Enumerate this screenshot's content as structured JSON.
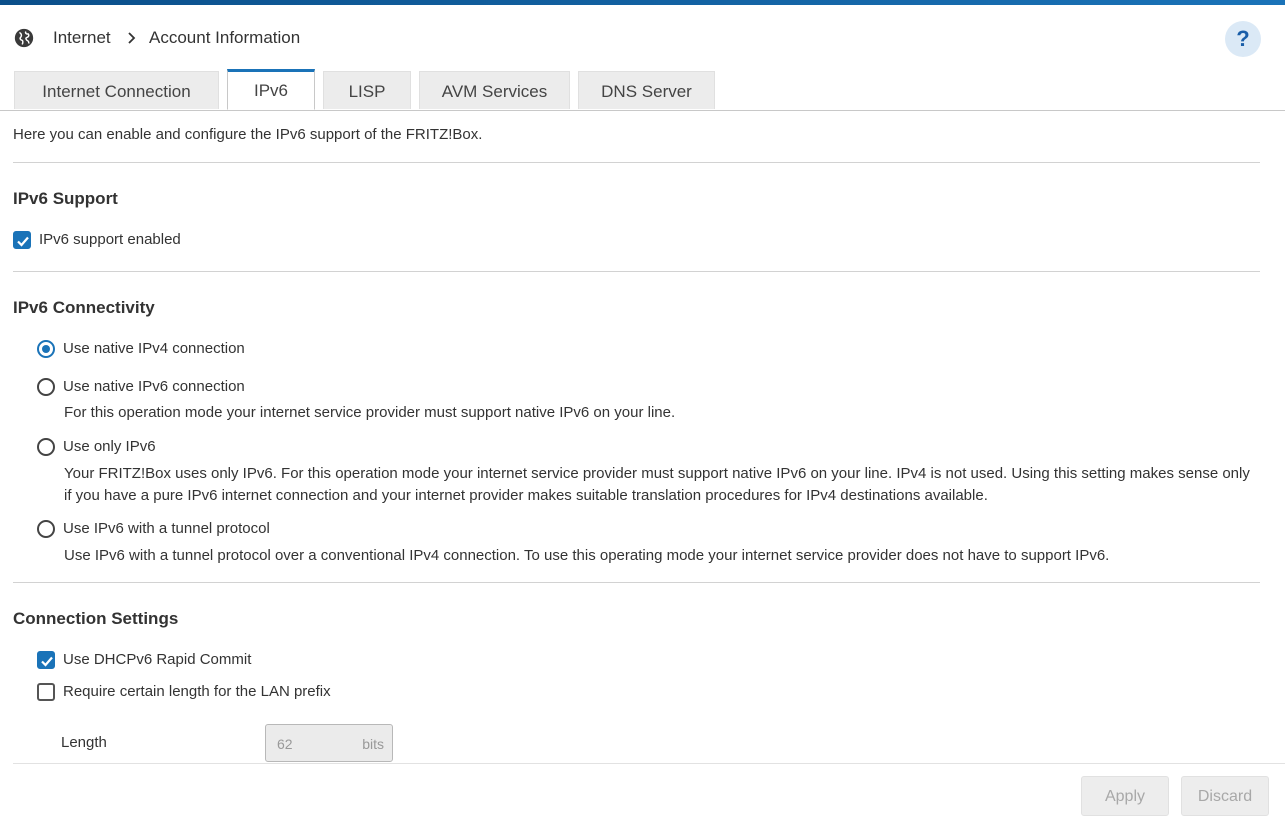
{
  "colors": {
    "accent": "#1a73b8",
    "topbar": "#0b4f8a",
    "help_bg": "#dbe9f6"
  },
  "breadcrumb": {
    "icon": "globe-icon",
    "root": "Internet",
    "separator_icon": "chevron-right-icon",
    "current": "Account Information"
  },
  "help": {
    "label": "?"
  },
  "tabs": [
    {
      "label": "Internet Connection",
      "active": false
    },
    {
      "label": "IPv6",
      "active": true
    },
    {
      "label": "LISP",
      "active": false
    },
    {
      "label": "AVM Services",
      "active": false
    },
    {
      "label": "DNS Server",
      "active": false
    }
  ],
  "intro": "Here you can enable and configure the IPv6 support of the FRITZ!Box.",
  "ipv6_support": {
    "heading": "IPv6 Support",
    "checkbox_label": "IPv6 support enabled",
    "checked": true
  },
  "connectivity": {
    "heading": "IPv6 Connectivity",
    "options": [
      {
        "label": "Use native IPv4 connection",
        "selected": true,
        "desc": ""
      },
      {
        "label": "Use native IPv6 connection",
        "selected": false,
        "desc": "For this operation mode your internet service provider must support native IPv6 on your line."
      },
      {
        "label": "Use only IPv6",
        "selected": false,
        "desc": "Your FRITZ!Box uses only IPv6. For this operation mode your internet service provider must support native IPv6 on your line. IPv4 is not used. Using this setting makes sense only if you have a pure IPv6 internet connection and your internet provider makes suitable translation procedures for IPv4 destinations available."
      },
      {
        "label": "Use IPv6 with a tunnel protocol",
        "selected": false,
        "desc": "Use IPv6 with a tunnel protocol over a conventional IPv4 connection. To use this operating mode your internet service provider does not have to support IPv6."
      }
    ]
  },
  "connection_settings": {
    "heading": "Connection Settings",
    "rapid_commit_label": "Use DHCPv6 Rapid Commit",
    "rapid_commit_checked": true,
    "prefix_length_label": "Require certain length for the LAN prefix",
    "prefix_length_checked": false,
    "length_label": "Length",
    "length_value": "62",
    "length_unit": "bits"
  },
  "footer": {
    "apply_label": "Apply",
    "discard_label": "Discard"
  }
}
